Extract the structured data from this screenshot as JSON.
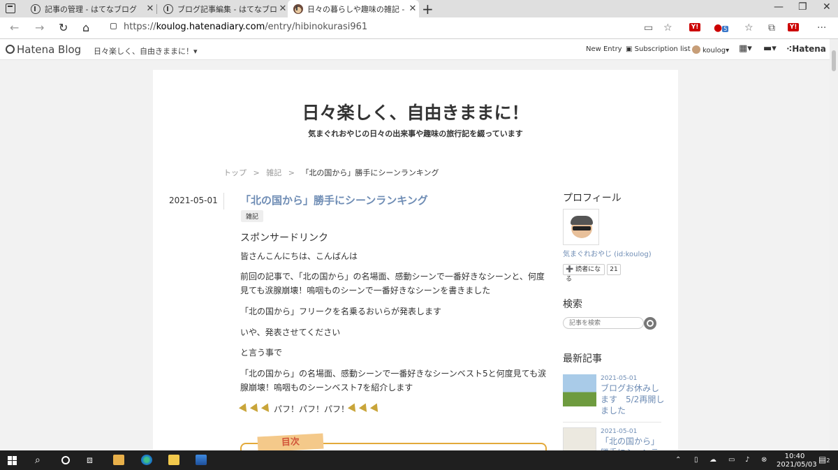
{
  "browser": {
    "tabs": [
      {
        "title": "記事の管理 - はてなブログ"
      },
      {
        "title": "ブログ記事編集 - はてなブログ"
      },
      {
        "title": "日々の暮らしや趣味の雑記 - 日々の",
        "active": true
      }
    ],
    "url_prefix": "https://",
    "url_host": "koulog.hatenadiary.com",
    "url_path": "/entry/hibinokurasi961",
    "ext_badge": "5"
  },
  "hatena_bar": {
    "logo": "Hatena Blog",
    "blog_name": "日々楽しく、自由きままに！▾",
    "new_entry": "New Entry",
    "subscription": "Subscription list",
    "user": "koulog▾",
    "hatena": "Hatena"
  },
  "blog": {
    "title": "日々楽しく、自由きままに！",
    "description": "気まぐれおやじの日々の出来事や趣味の旅行記を綴っています"
  },
  "breadcrumb": {
    "top": "トップ",
    "sep": ">",
    "category": "雑記",
    "current": "「北の国から」勝手にシーンランキング"
  },
  "entry": {
    "date": "2021-05-01",
    "title": "「北の国から」勝手にシーンランキング",
    "category": "雑記",
    "sponsored": "スポンサードリンク",
    "paragraphs": [
      "皆さんこんにちは、こんばんは",
      "前回の記事で、「北の国から」の名場面、感動シーンで一番好きなシーンと、何度見ても涙腺崩壊！嗚咽ものシーンで一番好きなシーンを書きました",
      "「北の国から」フリークを名乗るおいらが発表します",
      "いや、発表させてください",
      "と言う事で",
      "「北の国から」の名場面、感動シーンで一番好きなシーンベスト5と何度見ても涙腺崩壊！嗚咽ものシーンベスト7を紹介します"
    ],
    "party": "パフ！パフ！パフ！",
    "toc_label": "目次"
  },
  "sidebar": {
    "profile_heading": "プロフィール",
    "profile_name": "気まぐれおやじ (id:koulog)",
    "reader_button": "➕ 読者になる",
    "reader_count": "21",
    "search_heading": "検索",
    "search_placeholder": "記事を検索",
    "recent_heading": "最新記事",
    "recent": [
      {
        "date": "2021-05-01",
        "title": "ブログお休みします　5/2再開しました"
      },
      {
        "date": "2021-05-01",
        "title": "「北の国から」勝手にシーンランキング"
      }
    ]
  },
  "taskbar": {
    "time": "10:40",
    "date": "2021/05/03",
    "notif": "2"
  }
}
